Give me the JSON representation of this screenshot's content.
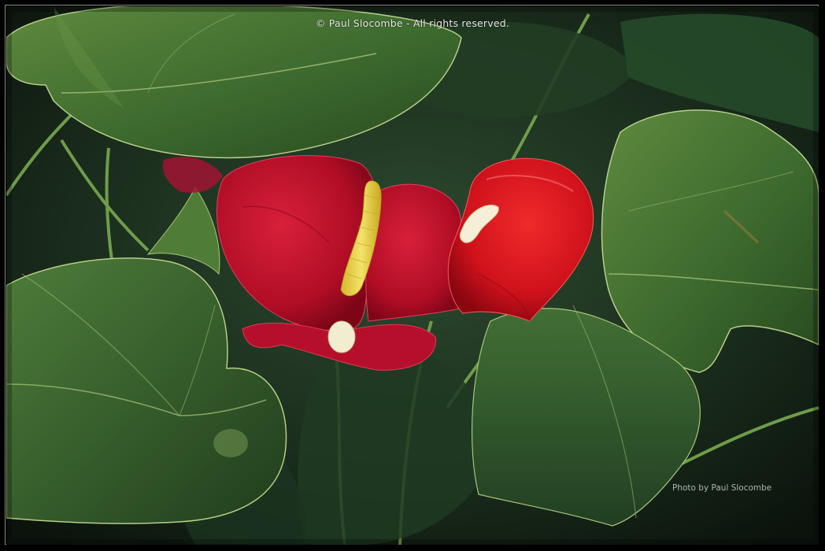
{
  "image": {
    "subject": "red-anthurium-flowers",
    "copyright_text": "© Paul Slocombe - All rights reserved.",
    "credit_text": "Photo by Paul Slocombe",
    "colors": {
      "background": "#000000",
      "border": "#8a8a8a",
      "spathe_red": "#c4102a",
      "spadix_yellow": "#e8d24a",
      "leaf_green": "#3e6b2e",
      "leaf_dark": "#1c3a20"
    }
  }
}
